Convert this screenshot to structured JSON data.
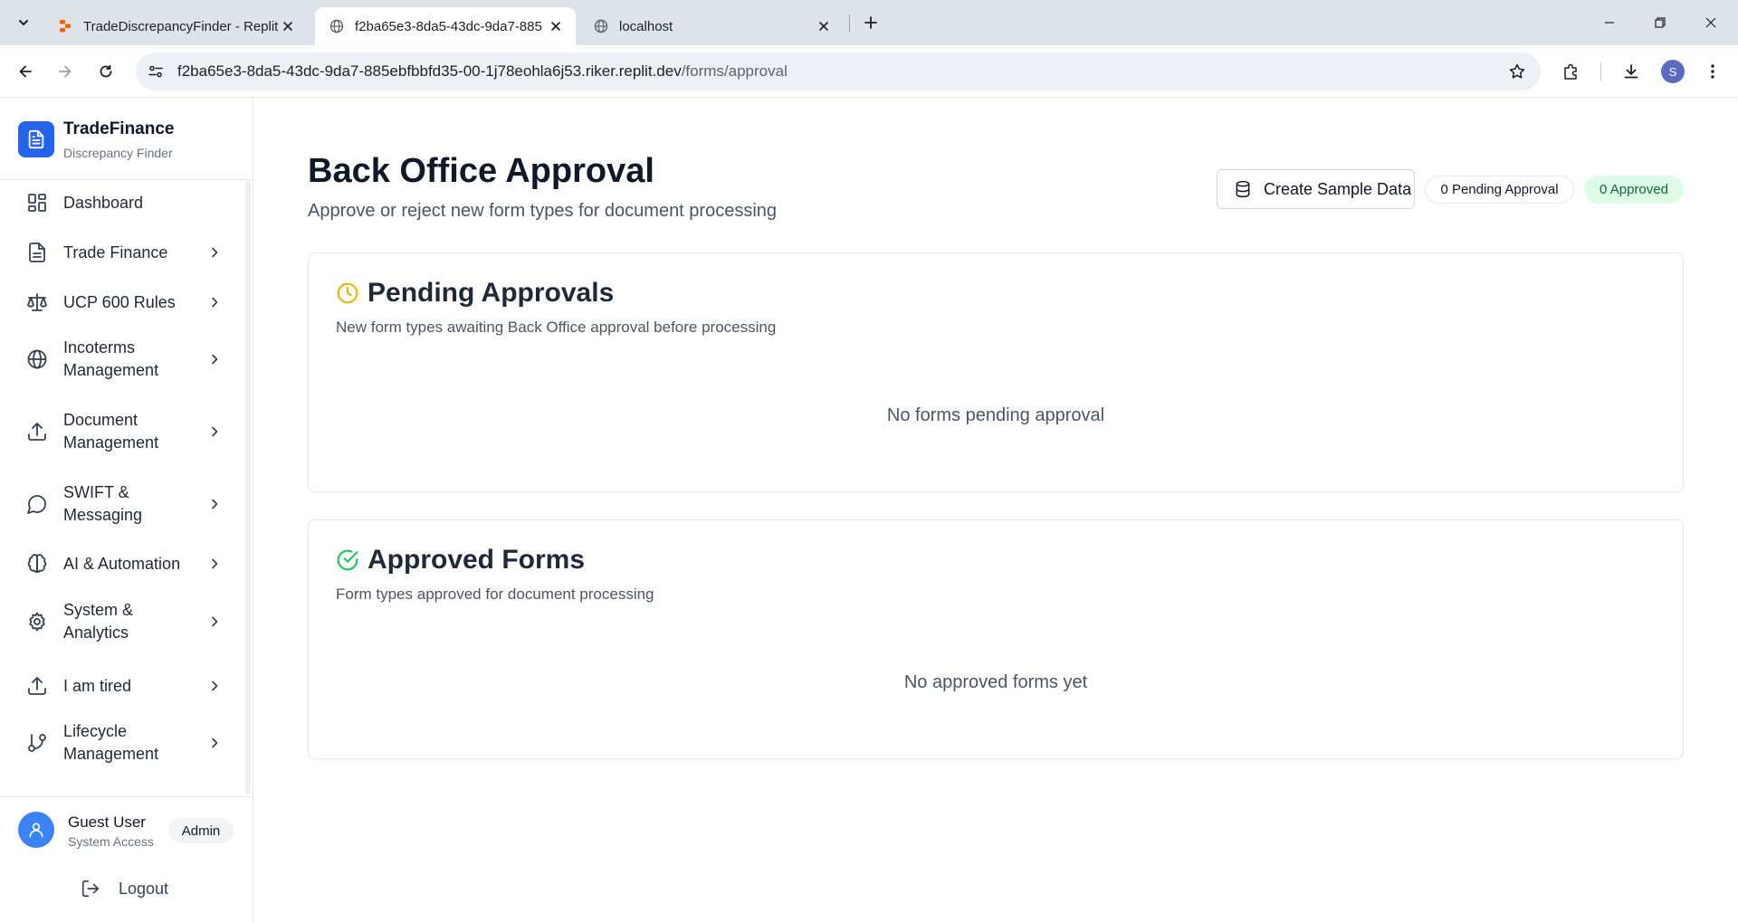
{
  "browser": {
    "tabs": [
      {
        "title": "TradeDiscrepancyFinder - Replit",
        "active": false,
        "favicon": "replit-icon"
      },
      {
        "title": "f2ba65e3-8da5-43dc-9da7-885",
        "active": true,
        "favicon": "globe-icon"
      },
      {
        "title": "localhost",
        "active": false,
        "favicon": "globe-icon"
      }
    ],
    "url_host": "f2ba65e3-8da5-43dc-9da7-885ebfbbfd35-00-1j78eohla6j53.riker.replit.dev",
    "url_path": "/forms/approval",
    "profile_initial": "S"
  },
  "sidebar": {
    "brand_name": "TradeFinance",
    "brand_sub": "Discrepancy Finder",
    "items": [
      {
        "label": "Dashboard",
        "icon": "dashboard-icon",
        "expandable": false
      },
      {
        "label": "Trade Finance",
        "icon": "document-icon",
        "expandable": true
      },
      {
        "label": "UCP 600 Rules",
        "icon": "scale-icon",
        "expandable": true
      },
      {
        "label": "Incoterms Management",
        "icon": "globe-icon",
        "expandable": true
      },
      {
        "label": "Document Management",
        "icon": "upload-icon",
        "expandable": true
      },
      {
        "label": "SWIFT & Messaging",
        "icon": "message-icon",
        "expandable": true
      },
      {
        "label": "AI & Automation",
        "icon": "brain-icon",
        "expandable": true
      },
      {
        "label": "System & Analytics",
        "icon": "gear-icon",
        "expandable": true
      },
      {
        "label": "I am tired",
        "icon": "upload-icon",
        "expandable": true
      },
      {
        "label": "Lifecycle Management",
        "icon": "git-branch-icon",
        "expandable": true
      }
    ],
    "user": {
      "name": "Guest User",
      "role": "System Access",
      "badge": "Admin",
      "logout_label": "Logout"
    }
  },
  "main": {
    "title": "Back Office Approval",
    "subtitle": "Approve or reject new form types for document processing",
    "create_sample_label": "Create Sample Data",
    "pending_badge": "0 Pending Approval",
    "approved_badge": "0 Approved",
    "pending_card": {
      "title": "Pending Approvals",
      "subtitle": "New form types awaiting Back Office approval before processing",
      "empty_text": "No forms pending approval"
    },
    "approved_card": {
      "title": "Approved Forms",
      "subtitle": "Form types approved for document processing",
      "empty_text": "No approved forms yet"
    }
  },
  "colors": {
    "accent": "#2563eb",
    "pending_icon": "#eab308",
    "approved_icon": "#22c55e",
    "approved_badge_bg": "#dcfce7"
  }
}
